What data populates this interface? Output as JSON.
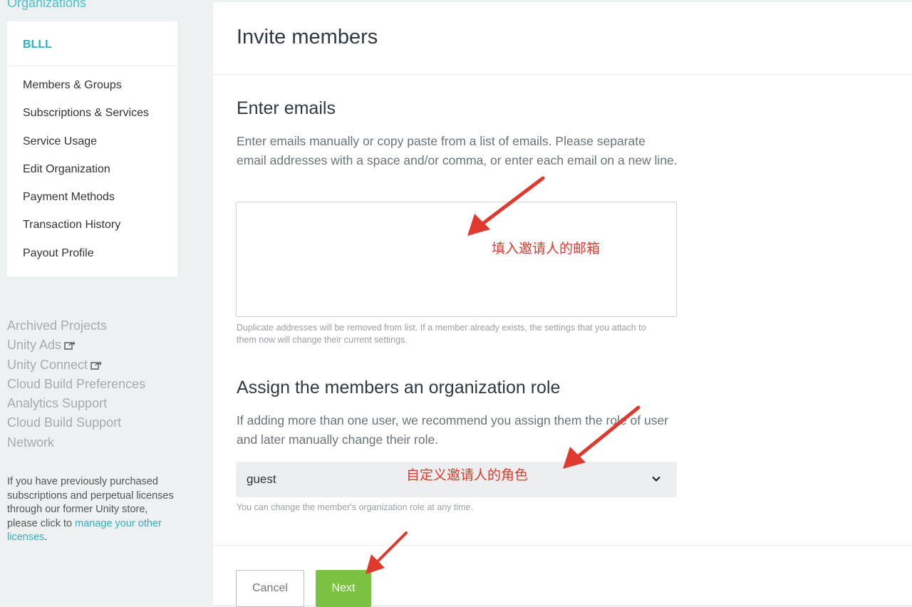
{
  "sidebar": {
    "org_link": "Organizations",
    "org_name": "BLLL",
    "menu": [
      {
        "label": "Members & Groups"
      },
      {
        "label": "Subscriptions & Services"
      },
      {
        "label": "Service Usage"
      },
      {
        "label": "Edit Organization"
      },
      {
        "label": "Payment Methods"
      },
      {
        "label": "Transaction History"
      },
      {
        "label": "Payout Profile"
      }
    ],
    "external_links": [
      {
        "label": "Archived Projects",
        "icon": ""
      },
      {
        "label": "Unity Ads",
        "icon": "external-link-icon"
      },
      {
        "label": "Unity Connect",
        "icon": "external-link-icon"
      },
      {
        "label": "Cloud Build Preferences",
        "icon": ""
      },
      {
        "label": "Analytics Support",
        "icon": ""
      },
      {
        "label": "Cloud Build Support",
        "icon": ""
      },
      {
        "label": "Network",
        "icon": ""
      }
    ],
    "legacy_note": {
      "text": "If you have previously purchased subscriptions and perpetual licenses through our former Unity store, please click to ",
      "link_text": "manage your other licenses",
      "suffix": "."
    }
  },
  "main": {
    "title": "Invite members",
    "emails_section": {
      "heading": "Enter emails",
      "description": "Enter emails manually or copy paste from a list of emails. Please separate email addresses with a space and/or comma, or enter each email on a new line.",
      "input_value": "",
      "help": "Duplicate addresses will be removed from list. If a member already exists, the settings that you attach to them now will change their current settings."
    },
    "role_section": {
      "heading": "Assign the members an organization role",
      "description": "If adding more than one user, we recommend you assign them the role of user and later manually change their role.",
      "selected_role": "guest",
      "help": "You can change the member's organization role at any time."
    },
    "buttons": {
      "cancel": "Cancel",
      "next": "Next"
    }
  },
  "annotations": {
    "email_note": "填入邀请人的邮箱",
    "role_note": "自定义邀请人的角色"
  },
  "colors": {
    "accent": "#2fb0c0",
    "next_button": "#7cc242",
    "annotation": "#e03a2f"
  }
}
